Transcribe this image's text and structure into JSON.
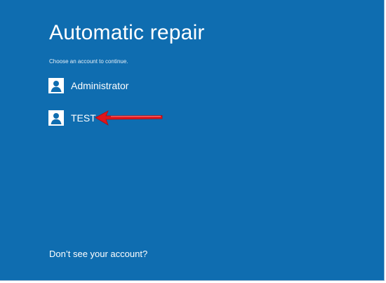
{
  "page": {
    "title": "Automatic repair",
    "subtitle": "Choose an account to continue."
  },
  "accounts": [
    {
      "label": "Administrator",
      "icon": "user-icon"
    },
    {
      "label": "TEST",
      "icon": "user-icon"
    }
  ],
  "footer": {
    "link_label": "Don’t see your account?"
  },
  "colors": {
    "background": "#0f6db0",
    "text": "#ffffff",
    "annotation_arrow": "#e0151b"
  }
}
